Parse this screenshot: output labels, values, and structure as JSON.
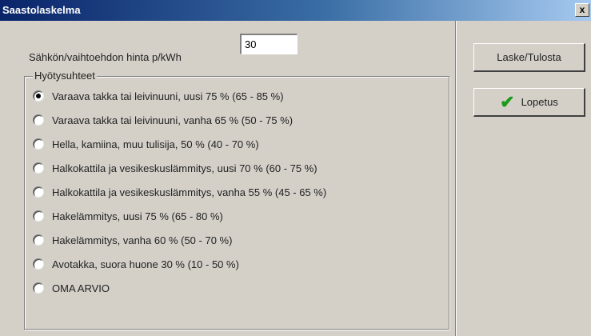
{
  "window": {
    "title": "Saastolaskelma",
    "close_label": "x"
  },
  "price": {
    "label": "Sähkön/vaihtoehdon hinta p/kWh",
    "value": "30"
  },
  "efficiency_group": {
    "title": "Hyötysuhteet",
    "selected_index": 0,
    "options": [
      "Varaava takka tai leivinuuni, uusi 75 % (65 - 85 %)",
      "Varaava takka tai leivinuuni, vanha 65 % (50 - 75 %)",
      "Hella, kamiina, muu tulisija, 50 % (40 - 70 %)",
      "Halkokattila ja vesikeskuslämmitys, uusi 70 % (60 - 75 %)",
      "Halkokattila ja vesikeskuslämmitys, vanha 55 % (45 - 65 %)",
      "Hakelämmitys, uusi 75 % (65 - 80 %)",
      "Hakelämmitys, vanha 60 % (50 - 70 %)",
      "Avotakka, suora huone 30 % (10 - 50 %)",
      "OMA ARVIO"
    ]
  },
  "buttons": {
    "calculate_label": "Laske/Tulosta",
    "exit_label": "Lopetus"
  },
  "colors": {
    "titlebar_start": "#0a246a",
    "titlebar_end": "#a6caf0",
    "check_green": "#1a9a1a"
  }
}
